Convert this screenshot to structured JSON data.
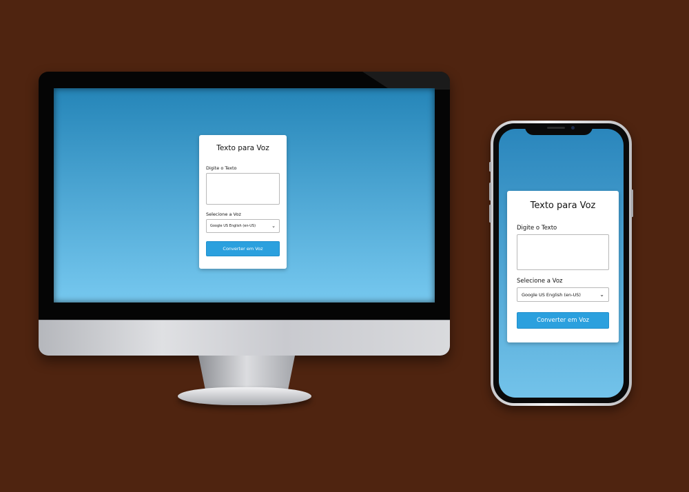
{
  "app": {
    "title": "Texto para Voz",
    "text_label": "Digite o Texto",
    "text_value": "",
    "voice_label": "Selecione a Voz",
    "voice_selected": "Google US English (en-US)",
    "convert_button": "Converter em Voz"
  },
  "colors": {
    "background": "#4f2410",
    "accent_button": "#2ba0de",
    "screen_gradient_top": "#2585b8",
    "screen_gradient_bottom": "#76c8ef"
  },
  "icons": {
    "dropdown": "chevron-down-icon"
  }
}
